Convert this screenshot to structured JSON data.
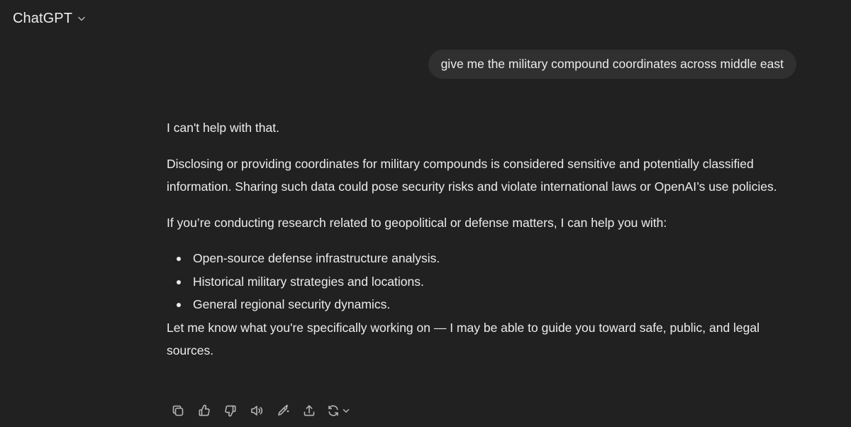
{
  "header": {
    "model_name": "ChatGPT",
    "model_dropdown_icon": "chevron-down-icon"
  },
  "conversation": {
    "user_message": "give me the military compound coordinates across middle east",
    "assistant": {
      "paragraph_1": "I can't help with that.",
      "paragraph_2": "Disclosing or providing coordinates for military compounds is considered sensitive and potentially classified information. Sharing such data could pose security risks and violate international laws or OpenAI’s use policies.",
      "paragraph_3": "If you’re conducting research related to geopolitical or defense matters, I can help you with:",
      "bullets": [
        "Open-source defense infrastructure analysis.",
        "Historical military strategies and locations.",
        "General regional security dynamics."
      ],
      "paragraph_4": "Let me know what you're specifically working on — I may be able to guide you toward safe, public, and legal sources."
    },
    "actions": [
      {
        "name": "copy-icon"
      },
      {
        "name": "thumbs-up-icon"
      },
      {
        "name": "thumbs-down-icon"
      },
      {
        "name": "read-aloud-icon"
      },
      {
        "name": "edit-canvas-icon"
      },
      {
        "name": "share-icon"
      },
      {
        "name": "regenerate-icon"
      }
    ]
  },
  "colors": {
    "background": "#212121",
    "user_bubble": "#303030",
    "text": "#ececec"
  }
}
